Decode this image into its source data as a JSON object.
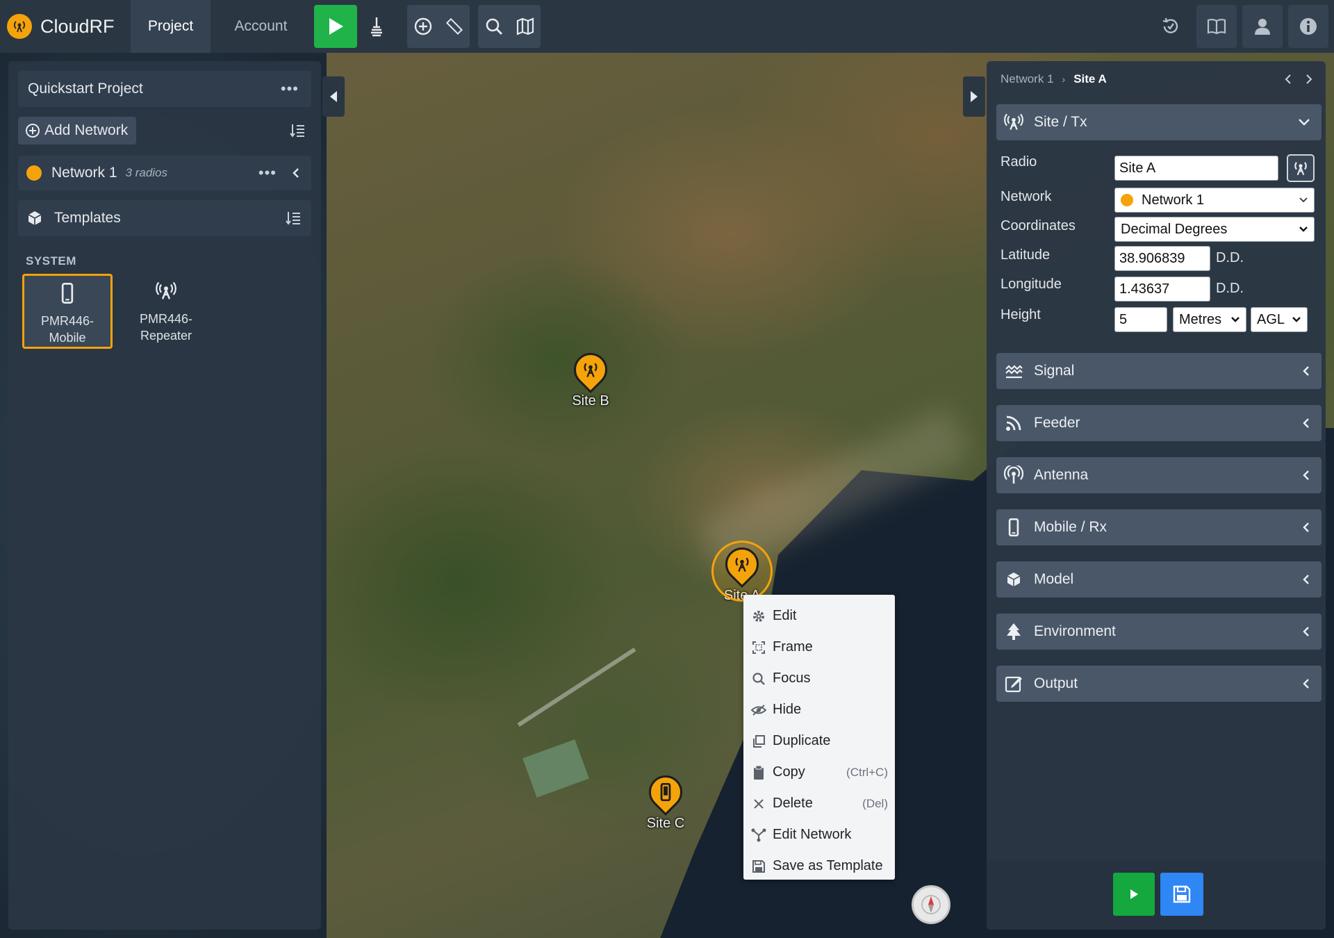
{
  "app": {
    "name": "CloudRF",
    "tabs": [
      {
        "label": "Project",
        "active": true
      },
      {
        "label": "Account",
        "active": false
      }
    ],
    "accent": "#f5a30a",
    "run_color": "#1fb34a",
    "save_color": "#2f86f5"
  },
  "toolbar_icons": [
    "play-icon",
    "clear-icon",
    "add-circle-icon",
    "ruler-icon",
    "search-icon",
    "map-book-icon"
  ],
  "toolbar_right_icons": [
    "history-icon",
    "docs-icon",
    "user-icon",
    "info-icon"
  ],
  "left_panel": {
    "project_name": "Quickstart Project",
    "project_menu": "•••",
    "add_network_label": "Add Network",
    "network": {
      "name": "Network 1",
      "count": "3 radios",
      "menu": "•••"
    },
    "templates_label": "Templates",
    "system_heading": "SYSTEM",
    "templates": [
      {
        "line1": "PMR446-",
        "line2": "Mobile",
        "icon": "mobile-icon",
        "selected": true
      },
      {
        "line1": "PMR446-",
        "line2": "Repeater",
        "icon": "antenna-icon",
        "selected": false
      }
    ]
  },
  "map": {
    "markers": [
      {
        "label": "Site B",
        "type": "antenna-icon"
      },
      {
        "label": "Site A",
        "type": "antenna-icon",
        "selected": true
      },
      {
        "label": "Site C",
        "type": "mobile-icon"
      }
    ]
  },
  "context_menu": {
    "items": [
      {
        "label": "Edit",
        "icon": "gear-icon",
        "shortcut": ""
      },
      {
        "label": "Frame",
        "icon": "frame-icon",
        "shortcut": ""
      },
      {
        "label": "Focus",
        "icon": "search-icon",
        "shortcut": ""
      },
      {
        "label": "Hide",
        "icon": "eye-slash-icon",
        "shortcut": ""
      },
      {
        "label": "Duplicate",
        "icon": "duplicate-icon",
        "shortcut": ""
      },
      {
        "label": "Copy",
        "icon": "clipboard-icon",
        "shortcut": "(Ctrl+C)"
      },
      {
        "label": "Delete",
        "icon": "close-icon",
        "shortcut": "(Del)"
      },
      {
        "label": "Edit Network",
        "icon": "network-icon",
        "shortcut": ""
      },
      {
        "label": "Save as Template",
        "icon": "save-icon",
        "shortcut": ""
      }
    ]
  },
  "right_panel": {
    "breadcrumb": {
      "parent": "Network 1",
      "current": "Site A"
    },
    "site_tx": {
      "title": "Site / Tx",
      "radio_label": "Radio",
      "radio_value": "Site A",
      "network_label": "Network",
      "network_value": "Network 1",
      "coordinates_label": "Coordinates",
      "coordinates_value": "Decimal Degrees",
      "latitude_label": "Latitude",
      "latitude_value": "38.906839",
      "longitude_label": "Longitude",
      "longitude_value": "1.43637",
      "unit_dd": "D.D.",
      "height_label": "Height",
      "height_value": "5",
      "height_unit": "Metres",
      "height_ref": "AGL"
    },
    "sections": [
      {
        "title": "Signal",
        "icon": "waves-icon"
      },
      {
        "title": "Feeder",
        "icon": "feed-icon"
      },
      {
        "title": "Antenna",
        "icon": "antenna-icon"
      },
      {
        "title": "Mobile / Rx",
        "icon": "mobile-icon"
      },
      {
        "title": "Model",
        "icon": "cube-icon"
      },
      {
        "title": "Environment",
        "icon": "tree-icon"
      },
      {
        "title": "Output",
        "icon": "edit-icon"
      }
    ]
  }
}
